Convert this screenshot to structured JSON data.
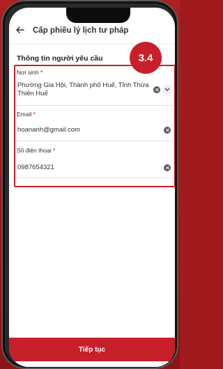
{
  "appbar": {
    "title": "Cấp phiếu lý lịch tư pháp"
  },
  "section": {
    "title": "Thông tin người yêu cầu"
  },
  "step_badge": "3.4",
  "fields": {
    "birthplace": {
      "label": "Nơi sinh",
      "required": "*",
      "value_line1": "Phường Gia Hội, Thành phố Huế, Tỉnh Thừa",
      "value_line2": "Thiên Huế"
    },
    "email": {
      "label": "Email",
      "required": "*",
      "value": "hoananh@gmail.com"
    },
    "phone": {
      "label": "Số điện thoại",
      "required": "*",
      "value": "0987654321"
    }
  },
  "continue_button": "Tiếp tục",
  "colors": {
    "brand_red": "#c8202a",
    "background": "#a11a1c"
  }
}
